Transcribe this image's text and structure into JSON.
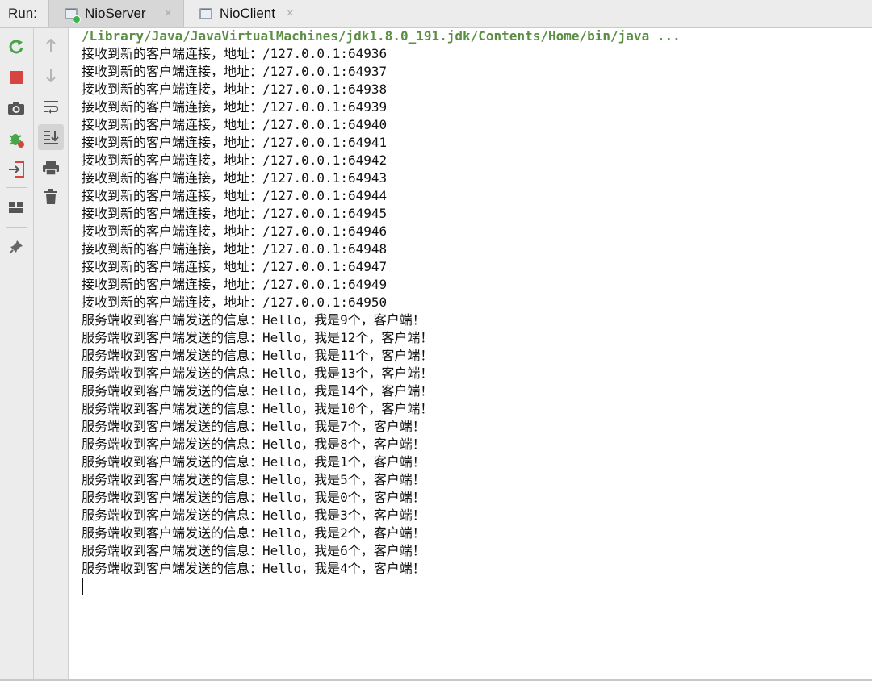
{
  "run_label": "Run:",
  "tabs": [
    {
      "label": "NioServer",
      "active": true,
      "close": "×"
    },
    {
      "label": "NioClient",
      "active": false,
      "close": "×"
    }
  ],
  "toolbar_left": [
    "rerun-icon",
    "stop-icon",
    "camera-icon",
    "debug-icon",
    "exit-icon",
    "layout-icon",
    "pin-icon"
  ],
  "toolbar_right": [
    "arrow-up-icon",
    "arrow-down-icon",
    "soft-wrap-icon",
    "scroll-to-end-icon",
    "print-icon",
    "trash-icon"
  ],
  "colors": {
    "command": "#5a8e43",
    "rerun": "#4aa54a",
    "stop": "#d64541"
  },
  "console": {
    "command": "/Library/Java/JavaVirtualMachines/jdk1.8.0_191.jdk/Contents/Home/bin/java ...",
    "lines": [
      "接收到新的客户端连接，地址：/127.0.0.1:64936",
      "接收到新的客户端连接，地址：/127.0.0.1:64937",
      "接收到新的客户端连接，地址：/127.0.0.1:64938",
      "接收到新的客户端连接，地址：/127.0.0.1:64939",
      "接收到新的客户端连接，地址：/127.0.0.1:64940",
      "接收到新的客户端连接，地址：/127.0.0.1:64941",
      "接收到新的客户端连接，地址：/127.0.0.1:64942",
      "接收到新的客户端连接，地址：/127.0.0.1:64943",
      "接收到新的客户端连接，地址：/127.0.0.1:64944",
      "接收到新的客户端连接，地址：/127.0.0.1:64945",
      "接收到新的客户端连接，地址：/127.0.0.1:64946",
      "接收到新的客户端连接，地址：/127.0.0.1:64948",
      "接收到新的客户端连接，地址：/127.0.0.1:64947",
      "接收到新的客户端连接，地址：/127.0.0.1:64949",
      "接收到新的客户端连接，地址：/127.0.0.1:64950",
      "服务端收到客户端发送的信息：Hello，我是9个，客户端！",
      "服务端收到客户端发送的信息：Hello，我是12个，客户端！",
      "服务端收到客户端发送的信息：Hello，我是11个，客户端！",
      "服务端收到客户端发送的信息：Hello，我是13个，客户端！",
      "服务端收到客户端发送的信息：Hello，我是14个，客户端！",
      "服务端收到客户端发送的信息：Hello，我是10个，客户端！",
      "服务端收到客户端发送的信息：Hello，我是7个，客户端！",
      "服务端收到客户端发送的信息：Hello，我是8个，客户端！",
      "服务端收到客户端发送的信息：Hello，我是1个，客户端！",
      "服务端收到客户端发送的信息：Hello，我是5个，客户端！",
      "服务端收到客户端发送的信息：Hello，我是0个，客户端！",
      "服务端收到客户端发送的信息：Hello，我是3个，客户端！",
      "服务端收到客户端发送的信息：Hello，我是2个，客户端！",
      "服务端收到客户端发送的信息：Hello，我是6个，客户端！",
      "服务端收到客户端发送的信息：Hello，我是4个，客户端！"
    ]
  }
}
